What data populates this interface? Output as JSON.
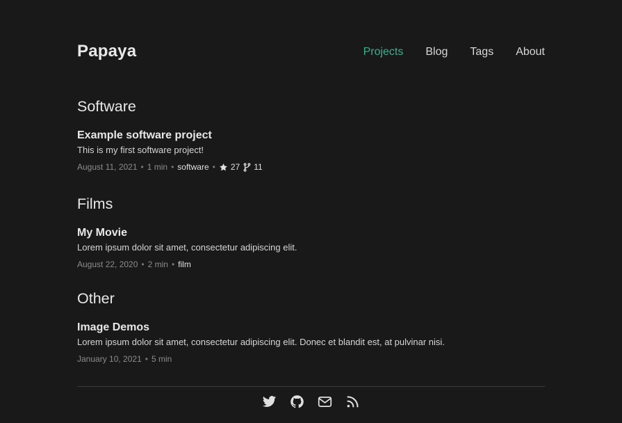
{
  "site": {
    "title": "Papaya"
  },
  "nav": {
    "items": [
      {
        "label": "Projects",
        "active": true
      },
      {
        "label": "Blog",
        "active": false
      },
      {
        "label": "Tags",
        "active": false
      },
      {
        "label": "About",
        "active": false
      }
    ]
  },
  "sections": [
    {
      "heading": "Software",
      "item": {
        "title": "Example software project",
        "description": "This is my first software project!",
        "date": "August 11, 2021",
        "read_time": "1 min",
        "tag": "software",
        "stars": "27",
        "forks": "11"
      }
    },
    {
      "heading": "Films",
      "item": {
        "title": "My Movie",
        "description": "Lorem ipsum dolor sit amet, consectetur adipiscing elit.",
        "date": "August 22, 2020",
        "read_time": "2 min",
        "tag": "film"
      }
    },
    {
      "heading": "Other",
      "item": {
        "title": "Image Demos",
        "description": "Lorem ipsum dolor sit amet, consectetur adipiscing elit. Donec et blandit est, at pulvinar nisi.",
        "date": "January 10, 2021",
        "read_time": "5 min"
      }
    }
  ],
  "footer": {
    "social": [
      "twitter-icon",
      "github-icon",
      "email-icon",
      "rss-icon"
    ]
  },
  "colors": {
    "background": "#191919",
    "accent": "#3fae8d",
    "text": "#e6e6e6",
    "muted": "#8c8c8c"
  },
  "meta_separator": "•"
}
